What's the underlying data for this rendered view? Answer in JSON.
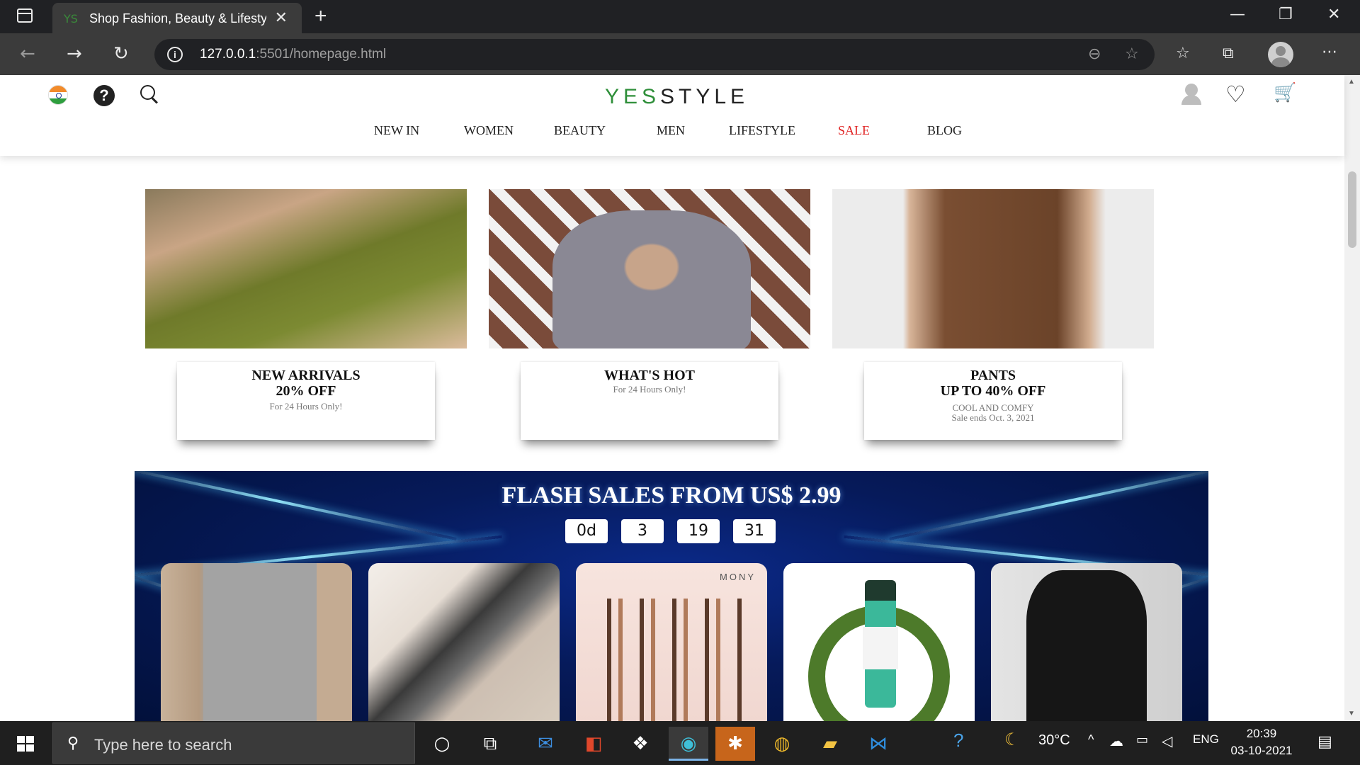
{
  "browser": {
    "tab_favicon": "YS",
    "tab_title": "Shop Fashion, Beauty & Lifestyle",
    "tab_close": "✕",
    "new_tab": "+",
    "url_host": "127.0.0.1",
    "url_path": ":5501/homepage.html",
    "window_minimize": "—",
    "window_maximize": "❐",
    "window_close": "✕"
  },
  "site": {
    "logo_green": "YES",
    "logo_dark": "STYLE",
    "nav": [
      {
        "label": "NEW IN"
      },
      {
        "label": "WOMEN"
      },
      {
        "label": "BEAUTY"
      },
      {
        "label": "MEN"
      },
      {
        "label": "LIFESTYLE"
      },
      {
        "label": "SALE",
        "color": "#e02020"
      },
      {
        "label": "BLOG"
      }
    ],
    "icons": [
      "india-flag-icon",
      "help-icon",
      "search-icon",
      "user-icon",
      "heart-icon",
      "cart-icon"
    ]
  },
  "promos": [
    {
      "title": "NEW ARRIVALS",
      "title2": "20% OFF",
      "sub": "For 24 Hours Only!",
      "sub2": ""
    },
    {
      "title": "WHAT'S HOT",
      "title2": "",
      "sub": "For 24 Hours Only!",
      "sub2": ""
    },
    {
      "title": "PANTS",
      "title2": "UP TO 40% OFF",
      "sub": "COOL AND COMFY",
      "sub2": "Sale ends Oct. 3, 2021"
    }
  ],
  "flash_sale": {
    "title": "FLASH SALES FROM US$ 2.99",
    "timer": [
      "0d",
      "3",
      "19",
      "31"
    ],
    "product_brand_3": "MONY"
  },
  "taskbar": {
    "search_placeholder": "Type here to search",
    "temperature": "30°C",
    "language": "ENG",
    "time": "20:39",
    "date": "03-10-2021"
  },
  "colors": {
    "brand_green": "#2f8f3a",
    "sale_red": "#e02020",
    "flash_bg": "#061a5a"
  }
}
